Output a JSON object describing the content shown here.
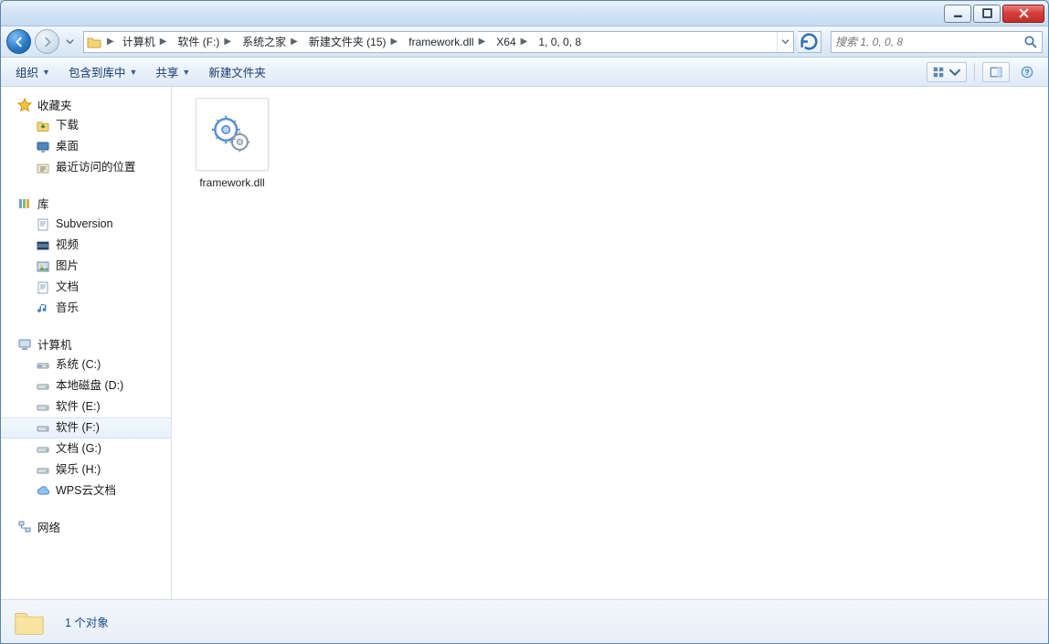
{
  "breadcrumb": [
    {
      "label": "计算机"
    },
    {
      "label": "软件 (F:)"
    },
    {
      "label": "系统之家"
    },
    {
      "label": "新建文件夹 (15)"
    },
    {
      "label": "framework.dll"
    },
    {
      "label": "X64"
    },
    {
      "label": "1, 0, 0, 8"
    }
  ],
  "search": {
    "placeholder": "搜索 1, 0, 0, 8"
  },
  "toolbar": {
    "organize": "组织",
    "include": "包含到库中",
    "share": "共享",
    "new_folder": "新建文件夹"
  },
  "sidebar": {
    "favorites": {
      "header": "收藏夹",
      "items": [
        {
          "label": "下载",
          "icon": "download-icon"
        },
        {
          "label": "桌面",
          "icon": "desktop-icon"
        },
        {
          "label": "最近访问的位置",
          "icon": "recent-icon"
        }
      ]
    },
    "libraries": {
      "header": "库",
      "items": [
        {
          "label": "Subversion",
          "icon": "doc-icon"
        },
        {
          "label": "视频",
          "icon": "video-icon"
        },
        {
          "label": "图片",
          "icon": "picture-icon"
        },
        {
          "label": "文档",
          "icon": "doc-icon"
        },
        {
          "label": "音乐",
          "icon": "music-icon"
        }
      ]
    },
    "computer": {
      "header": "计算机",
      "items": [
        {
          "label": "系统 (C:)",
          "icon": "drive-system-icon"
        },
        {
          "label": "本地磁盘 (D:)",
          "icon": "drive-icon"
        },
        {
          "label": "软件 (E:)",
          "icon": "drive-icon"
        },
        {
          "label": "软件 (F:)",
          "icon": "drive-icon",
          "selected": true
        },
        {
          "label": "文档 (G:)",
          "icon": "drive-icon"
        },
        {
          "label": "娱乐 (H:)",
          "icon": "drive-icon"
        },
        {
          "label": "WPS云文档",
          "icon": "cloud-icon"
        }
      ]
    },
    "network": {
      "header": "网络"
    }
  },
  "files": [
    {
      "name": "framework.dll"
    }
  ],
  "status": {
    "text": "1 个对象"
  }
}
